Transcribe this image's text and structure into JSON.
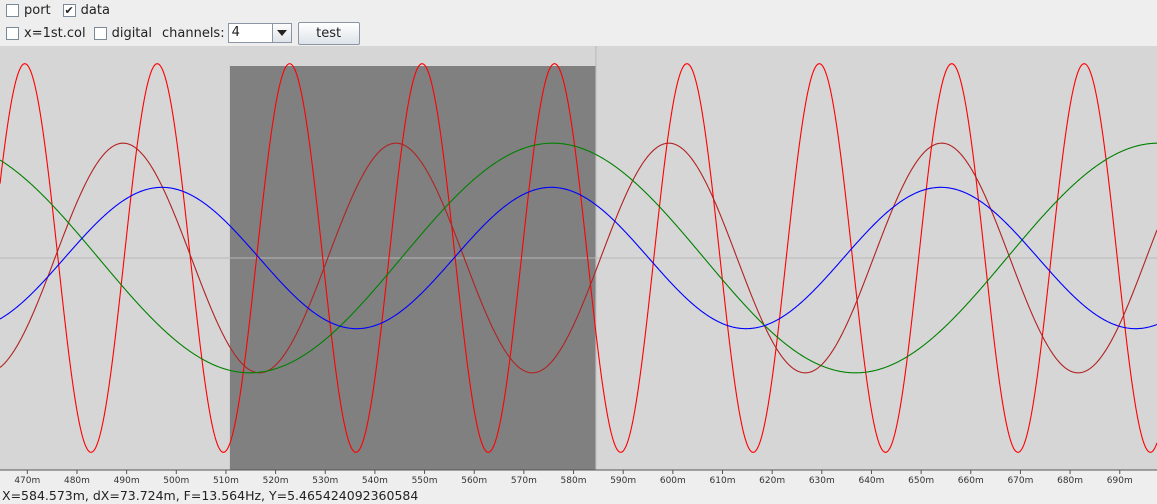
{
  "toolbar": {
    "port": {
      "label": "port",
      "checked": false
    },
    "data": {
      "label": "data",
      "checked": true
    },
    "x_first_col": {
      "label": "x=1st.col",
      "checked": false
    },
    "digital": {
      "label": "digital",
      "checked": false
    },
    "channels_label": "channels:",
    "channels_value": "4",
    "test_label": "test"
  },
  "status_text": "X=584.573m, dX=73.724m, F=13.564Hz, Y=5.465424092360584",
  "chart_data": {
    "type": "line",
    "title": "",
    "xlabel": "",
    "ylabel": "",
    "xlim": [
      0.4645,
      0.6975
    ],
    "ylim": [
      -12,
      12
    ],
    "x_tick_labels": [
      "470m",
      "480m",
      "490m",
      "500m",
      "510m",
      "520m",
      "530m",
      "540m",
      "550m",
      "560m",
      "570m",
      "580m",
      "590m",
      "600m",
      "610m",
      "620m",
      "630m",
      "640m",
      "650m",
      "660m",
      "670m",
      "680m",
      "690m"
    ],
    "x_ticks": [
      0.47,
      0.48,
      0.49,
      0.5,
      0.51,
      0.52,
      0.53,
      0.54,
      0.55,
      0.56,
      0.57,
      0.58,
      0.59,
      0.6,
      0.61,
      0.62,
      0.63,
      0.64,
      0.65,
      0.66,
      0.67,
      0.68,
      0.69
    ],
    "selection": {
      "x_start": 0.5108,
      "x_end": 0.5845
    },
    "cursor_x": 0.5845,
    "zero_line_y": 0,
    "background_color": "#d6d6d6",
    "selection_color": "#808080",
    "series": [
      {
        "color": "#ff0000",
        "amplitude": 11,
        "frequency_hz": 37.5,
        "phase_x": 0.4695
      },
      {
        "color": "#b22222",
        "amplitude": 6.5,
        "frequency_hz": 18.2,
        "phase_x": 0.4893
      },
      {
        "color": "#008000",
        "amplitude": 6.5,
        "frequency_hz": 8.2,
        "phase_x": 0.5758
      },
      {
        "color": "#0000ff",
        "amplitude": 4,
        "frequency_hz": 12.75,
        "phase_x": 0.4971
      }
    ]
  }
}
